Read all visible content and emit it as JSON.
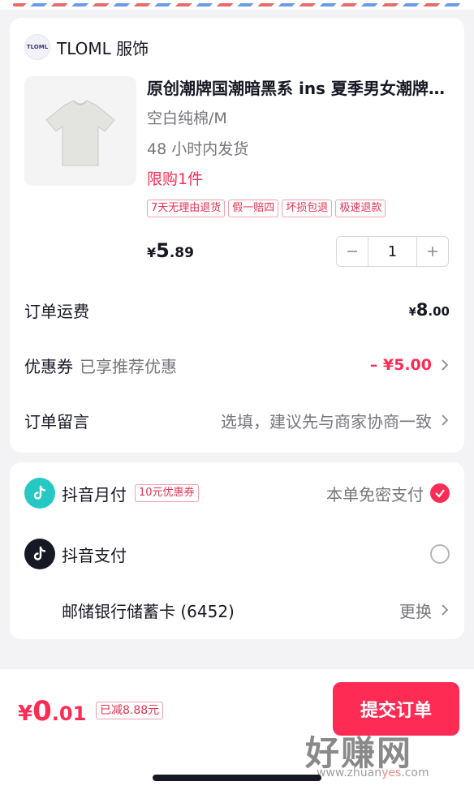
{
  "shop": {
    "logo_text": "TLOML",
    "name": "TLOML 服饰"
  },
  "product": {
    "title": "原创潮牌国潮暗黑系 ins 夏季男女潮牌宽松短袖T恤",
    "sku": "空白纯棉/M",
    "shipping": "48 小时内发货",
    "limit": "限购1件",
    "tags": [
      "7天无理由退货",
      "假一赔四",
      "坏损包退",
      "极速退款"
    ],
    "price": {
      "currency": "¥",
      "int": "5",
      "dec": ".89"
    },
    "quantity": "1"
  },
  "order": {
    "freight_label": "订单运费",
    "freight": {
      "currency": "¥",
      "int": "8",
      "dec": ".00"
    },
    "coupon_label": "优惠券",
    "coupon_sub": "已享推荐优惠",
    "coupon_value": "– ¥5.00",
    "note_label": "订单留言",
    "note_placeholder": "选填，建议先与商家协商一致"
  },
  "payment": {
    "monthly": {
      "label": "抖音月付",
      "coupon": "10元优惠券",
      "note": "本单免密支付",
      "selected": true
    },
    "douyin_pay": {
      "label": "抖音支付",
      "selected": false
    },
    "bank": {
      "label": "邮储银行储蓄卡 (6452)",
      "action": "更换"
    }
  },
  "footer": {
    "total": {
      "currency": "¥",
      "int": "0",
      "dec": ".01"
    },
    "saved": "已减8.88元",
    "submit_label": "提交订单"
  },
  "watermark": {
    "text": "好赚网",
    "url_pre": "www.zhuan",
    "url_hl": "yes",
    "url_post": ".com"
  },
  "colors": {
    "accent": "#fe2c55",
    "monthly_icon": "#25c8c3",
    "douyin_icon": "#161823"
  },
  "icons": [
    "minus-icon",
    "plus-icon",
    "chevron-right-icon",
    "douyin-monthly-icon",
    "douyin-pay-icon",
    "check-icon",
    "radio-icon"
  ]
}
